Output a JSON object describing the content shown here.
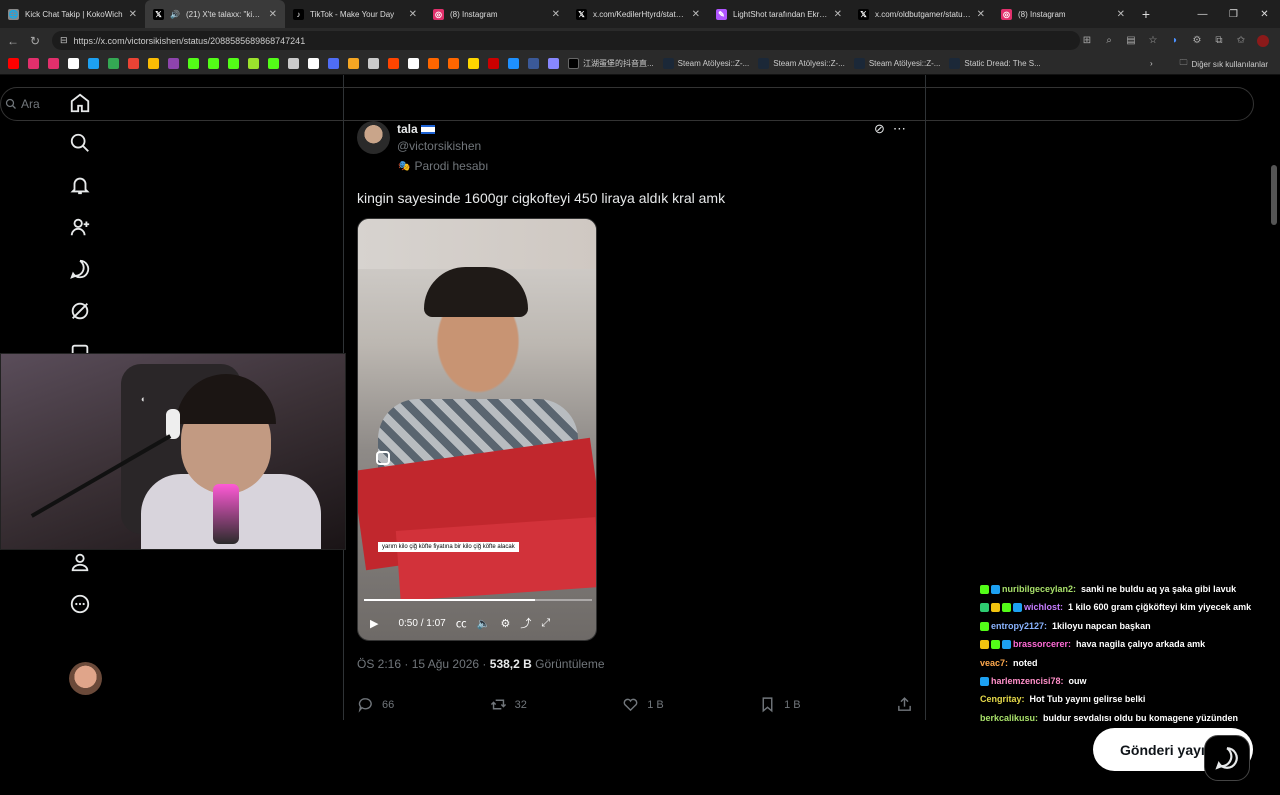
{
  "browser": {
    "tabs": [
      {
        "title": "Kick Chat Takip | KokoWich",
        "icon": "globe-icon",
        "active": false
      },
      {
        "title": "(21) X'te talaxx: \"kingin s",
        "icon": "x-logo-icon",
        "active": true
      },
      {
        "title": "TikTok - Make Your Day",
        "icon": "tiktok-icon",
        "active": false
      },
      {
        "title": "(8) Instagram",
        "icon": "instagram-icon",
        "active": false
      },
      {
        "title": "x.com/KedilerHtyrd/status/20",
        "icon": "x-logo-icon",
        "active": false
      },
      {
        "title": "LightShot tarafından Ekran G",
        "icon": "lightshot-icon",
        "active": false
      },
      {
        "title": "x.com/oldbutgamer/status/2(",
        "icon": "x-logo-icon",
        "active": false
      },
      {
        "title": "(8) Instagram",
        "icon": "instagram-icon",
        "active": false
      }
    ],
    "url": "https://x.com/victorsikishen/status/2088585689868747241",
    "bookmarks": [
      {
        "label": "",
        "color": "#ff0000"
      },
      {
        "label": "",
        "color": "#e1306c"
      },
      {
        "label": "",
        "color": "#e1306c"
      },
      {
        "label": "",
        "color": "#ffffff"
      },
      {
        "label": "",
        "color": "#1da1f2"
      },
      {
        "label": "",
        "color": "#34a853"
      },
      {
        "label": "",
        "color": "#ea4335"
      },
      {
        "label": "",
        "color": "#fbbc04"
      },
      {
        "label": "",
        "color": "#8e44ad"
      },
      {
        "label": "",
        "color": "#53fc18"
      },
      {
        "label": "",
        "color": "#53fc18"
      },
      {
        "label": "",
        "color": "#53fc18"
      },
      {
        "label": "",
        "color": "#9be22d"
      },
      {
        "label": "",
        "color": "#53fc18"
      },
      {
        "label": "",
        "color": "#cccccc"
      },
      {
        "label": "",
        "color": "#ffffff"
      },
      {
        "label": "",
        "color": "#4f6df5"
      },
      {
        "label": "",
        "color": "#f5a623"
      },
      {
        "label": "",
        "color": "#cccccc"
      },
      {
        "label": "",
        "color": "#ff4500"
      },
      {
        "label": "",
        "color": "#ffffff"
      },
      {
        "label": "",
        "color": "#ff6600"
      },
      {
        "label": "",
        "color": "#ff6600"
      },
      {
        "label": "",
        "color": "#ffd700"
      },
      {
        "label": "",
        "color": "#cc0000"
      },
      {
        "label": "",
        "color": "#1e90ff"
      },
      {
        "label": "",
        "color": "#3b5998"
      },
      {
        "label": "",
        "color": "#8888ff"
      },
      {
        "label": "江湖蛋堡的抖音直...",
        "color": "#000000"
      },
      {
        "label": "Steam Atölyesi::Z-...",
        "color": "#1b2838"
      },
      {
        "label": "Steam Atölyesi::Z-...",
        "color": "#1b2838"
      },
      {
        "label": "Steam Atölyesi::Z-...",
        "color": "#1b2838"
      },
      {
        "label": "Static Dread: The S...",
        "color": "#1b2838"
      }
    ],
    "bookmarks_folder": "Diğer sık kullanılanlar"
  },
  "x": {
    "search_placeholder": "Ara",
    "nav": [
      "home-icon",
      "explore-icon",
      "notifications-icon",
      "follow-icon",
      "messages-icon",
      "grok-icon",
      "bookmarks-icon",
      "profile-icon",
      "more-icon"
    ],
    "tweet": {
      "name": "tala",
      "handle": "@victorsikishen",
      "parody_label": "Parodi hesabı",
      "text": "kingin sayesinde 1600gr cigkofteyi 450 liraya aldık kral amk",
      "video": {
        "time": "0:50 / 1:07",
        "progress": 0.75,
        "caption": "yarım kilo çiğ köfte fiyatına bir kilo çiğ köfte alacak"
      },
      "meta_time": "ÖS 2:16 · 15 Ağu 2026 · ",
      "views_value": "538,2 B",
      "views_label": " Görüntüleme",
      "actions": {
        "replies": "66",
        "reposts": "32",
        "likes": "1 B",
        "bookmarks": "1 B"
      }
    },
    "post_button": "Gönderi yayı"
  },
  "chat": [
    {
      "user": "nuribilgeceylan2",
      "color": "#a8e06a",
      "message": "sanki ne buldu aq ya şaka gibi lavuk",
      "badges": [
        "#53fc18",
        "#1da1f2"
      ]
    },
    {
      "user": "wichlost",
      "color": "#c77dff",
      "message": "1 kilo 600 gram çiğköfteyi kim yiyecek amk",
      "badges": [
        "#2ecc71",
        "#f1c40f",
        "#53fc18",
        "#1da1f2"
      ]
    },
    {
      "user": "entropy2127",
      "color": "#8ab4ff",
      "message": "1kiloyu napcan başkan",
      "badges": [
        "#53fc18"
      ]
    },
    {
      "user": "brassorcerer",
      "color": "#ff6bd6",
      "message": "hava nagila çalıyo arkada amk",
      "badges": [
        "#f1c40f",
        "#53fc18",
        "#1da1f2"
      ]
    },
    {
      "user": "veac7",
      "color": "#ffa94d",
      "message": "noted",
      "badges": []
    },
    {
      "user": "harlemzencisi78",
      "color": "#ff8fc8",
      "message": "ouw",
      "badges": [
        "#1da1f2"
      ]
    },
    {
      "user": "Cengritay",
      "color": "#e6d94a",
      "message": "Hot Tub yayını gelirse belki",
      "badges": []
    },
    {
      "user": "berkcalikusu",
      "color": "#a8e06a",
      "message": "buldur sevdalısı oldu bu komagene yüzünden",
      "badges": []
    }
  ]
}
